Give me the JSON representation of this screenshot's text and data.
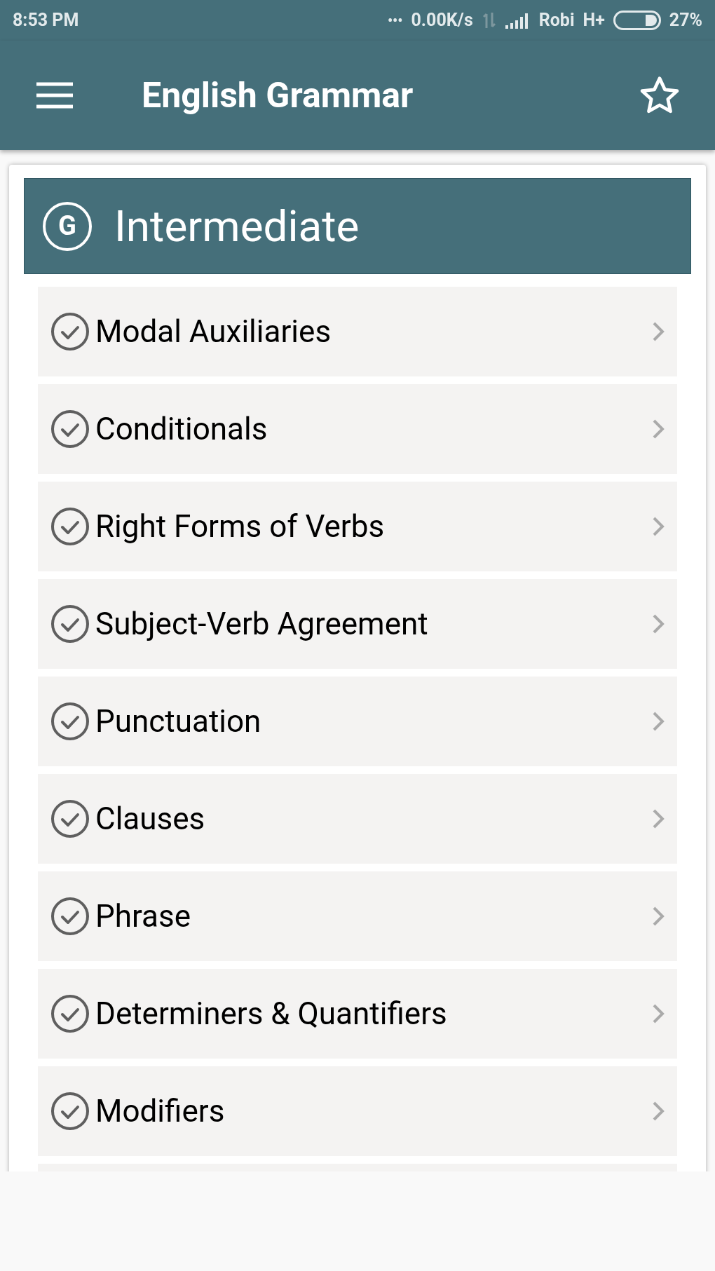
{
  "status_bar": {
    "time": "8:53 PM",
    "dots": "•••",
    "speed": "0.00K/s",
    "carrier": "Robi",
    "network": "H+",
    "battery": "27%"
  },
  "app_bar": {
    "title": "English Grammar"
  },
  "section": {
    "badge_letter": "G",
    "title": "Intermediate"
  },
  "items": [
    {
      "label": "Modal Auxiliaries",
      "completed": true
    },
    {
      "label": "Conditionals",
      "completed": true
    },
    {
      "label": "Right Forms of Verbs",
      "completed": true
    },
    {
      "label": "Subject-Verb Agreement",
      "completed": true
    },
    {
      "label": "Punctuation",
      "completed": true
    },
    {
      "label": "Clauses",
      "completed": true
    },
    {
      "label": "Phrase",
      "completed": true
    },
    {
      "label": "Determiners & Quantifiers",
      "completed": true
    },
    {
      "label": "Modifiers",
      "completed": true
    }
  ]
}
